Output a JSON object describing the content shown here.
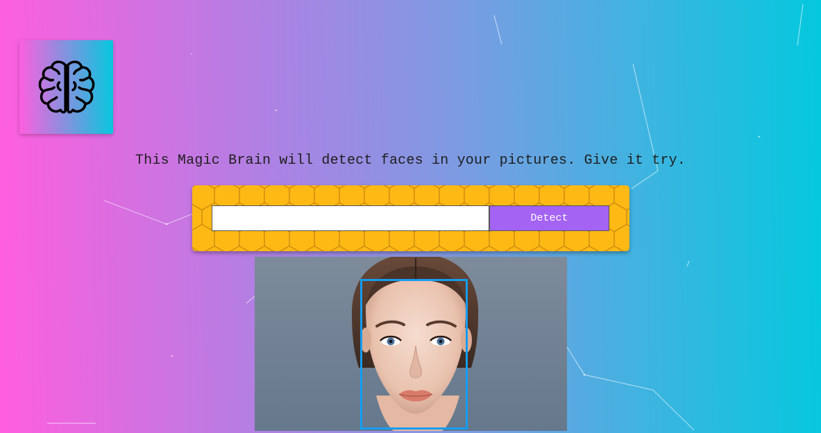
{
  "header": {
    "logo_icon": "brain-icon"
  },
  "intro": {
    "text": "This Magic Brain will detect faces in your pictures. Give it try."
  },
  "image_link_form": {
    "input_value": "",
    "input_placeholder": "",
    "detect_label": "Detect"
  },
  "result": {
    "image_subject": "woman-face",
    "face_box_color": "#149df2"
  },
  "colors": {
    "gradient_left": "#ff5edf",
    "gradient_right": "#04c8de",
    "panel_yellow": "#ffb914",
    "button_purple": "#a463f2"
  }
}
